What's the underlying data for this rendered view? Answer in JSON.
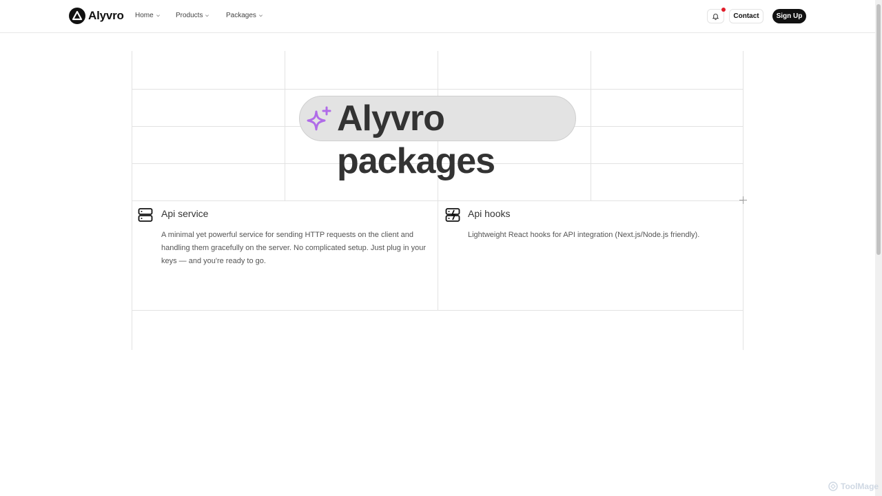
{
  "brand": {
    "name": "Alyvro"
  },
  "nav": {
    "items": [
      {
        "label": "Home"
      },
      {
        "label": "Products"
      },
      {
        "label": "Packages"
      }
    ]
  },
  "header_actions": {
    "contact_label": "Contact",
    "signup_label": "Sign Up",
    "notification_badge_color": "#e11d2a"
  },
  "hero": {
    "title": "Alyvro packages",
    "icon": "sparkles-icon",
    "icon_color": "#b06be8"
  },
  "cards": [
    {
      "title": "Api service",
      "icon": "server-icon",
      "description": "A minimal yet powerful service for sending HTTP requests on the client and handling them gracefully on the server. No complicated setup. Just plug in your keys — and you're ready to go."
    },
    {
      "title": "Api hooks",
      "icon": "server-bolt-icon",
      "description": "Lightweight React hooks for API integration (Next.js/Node.js friendly)."
    }
  ],
  "watermark": {
    "text": "ToolMage"
  }
}
